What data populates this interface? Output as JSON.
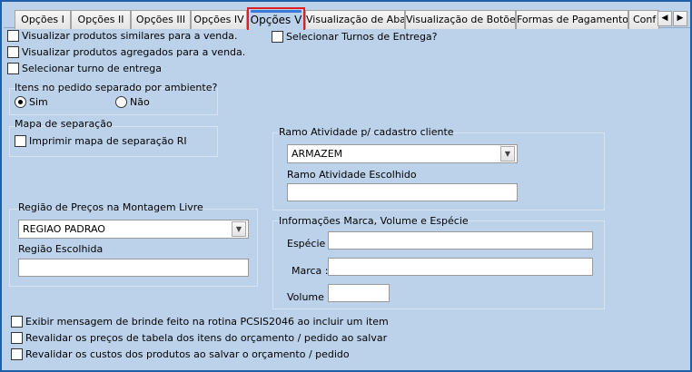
{
  "tabs": [
    {
      "label": "Opções I"
    },
    {
      "label": "Opções II"
    },
    {
      "label": "Opções III"
    },
    {
      "label": "Opções IV"
    },
    {
      "label": "Opções V"
    },
    {
      "label": "Visualização de Abas"
    },
    {
      "label": "Visualização de Botões"
    },
    {
      "label": "Formas de Pagamento"
    },
    {
      "label": "Conf"
    }
  ],
  "tab_arrows": {
    "left": "◀",
    "right": "▶"
  },
  "options": {
    "similar_products": "Visualizar produtos similares para a venda.",
    "aggregated_products": "Visualizar produtos agregados para a venda.",
    "select_delivery_shift": "Selecionar turno de entrega",
    "select_delivery_shifts_q": "Selecionar Turnos de Entrega?"
  },
  "separate_items": {
    "title": "Itens no pedido separado por ambiente?",
    "yes": "Sim",
    "no": "Não",
    "selected": "Sim"
  },
  "separation_map": {
    "title": "Mapa de separação",
    "print_label": "Imprimir mapa de separação RI"
  },
  "activity": {
    "title": "Ramo Atividade p/ cadastro cliente",
    "selected": "ARMAZEM",
    "chosen_label": "Ramo Atividade Escolhido",
    "chosen_value": ""
  },
  "price_region": {
    "title": "Região de Preços na Montagem Livre",
    "selected": "REGIAO PADRAO",
    "chosen_label": "Região Escolhida",
    "chosen_value": ""
  },
  "brand_info": {
    "title": "Informações Marca, Volume e Espécie",
    "species_label": "Espécie :",
    "brand_label": "Marca :",
    "volume_label": "Volume :",
    "species_value": "",
    "brand_value": "",
    "volume_value": ""
  },
  "bottom_options": {
    "gift_message": "Exibir mensagem de brinde feito na rotina PCSIS2046 ao incluir um item",
    "revalidate_prices": "Revalidar os preços de tabela dos itens do orçamento / pedido ao salvar",
    "revalidate_costs": "Revalidar os custos dos produtos ao salvar o orçamento / pedido"
  },
  "icons": {
    "dropdown": "▼"
  }
}
